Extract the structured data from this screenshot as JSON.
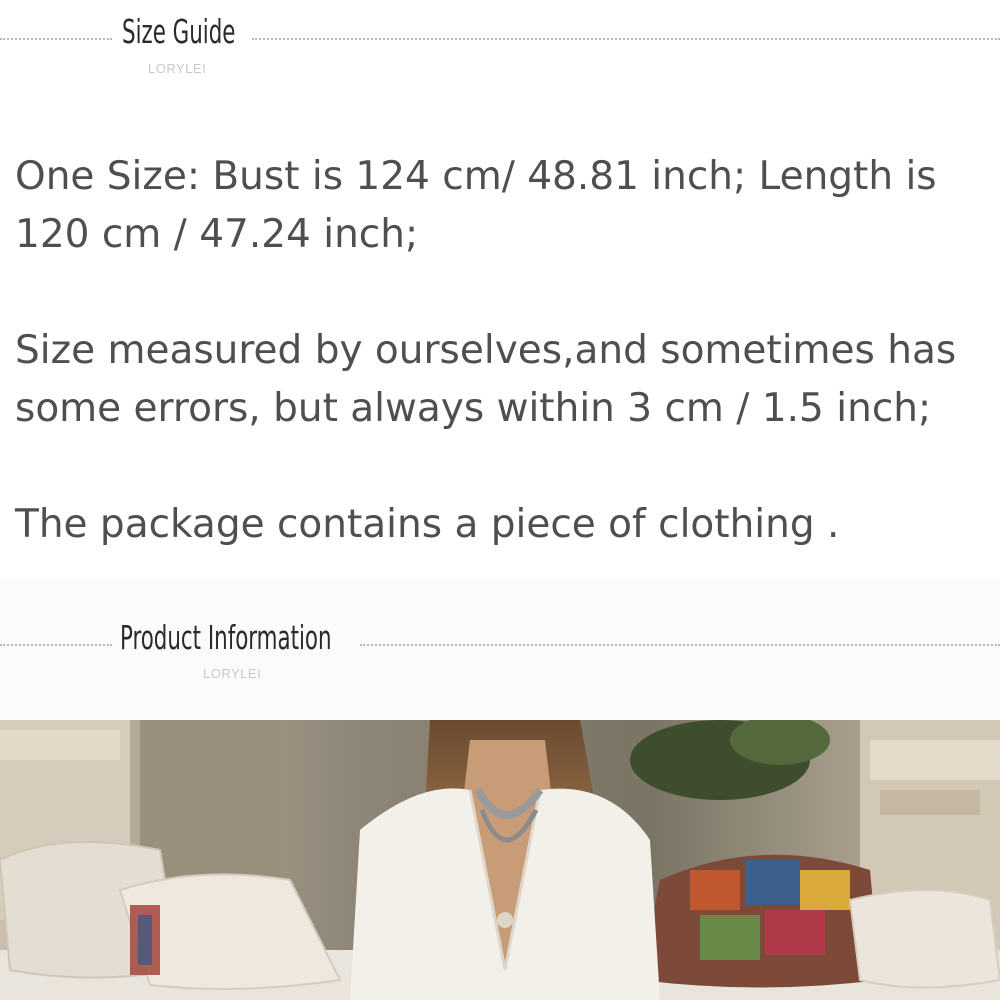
{
  "size_guide": {
    "title": "Size Guide",
    "brand": "LORYLEI",
    "paragraphs": [
      "One Size: Bust is 124 cm/ 48.81 inch; Length is 120 cm / 47.24 inch;",
      "Size measured by ourselves,and sometimes has some errors, but always within 3 cm / 1.5 inch;",
      "The package contains a piece of clothing ."
    ]
  },
  "product_info": {
    "title": "Product Information",
    "brand": "LORYLEI"
  },
  "colors": {
    "text": "#4f4f4f",
    "header": "#2a2a2a",
    "brand": "#c9c9c9",
    "dots": "#b8b8b8"
  }
}
